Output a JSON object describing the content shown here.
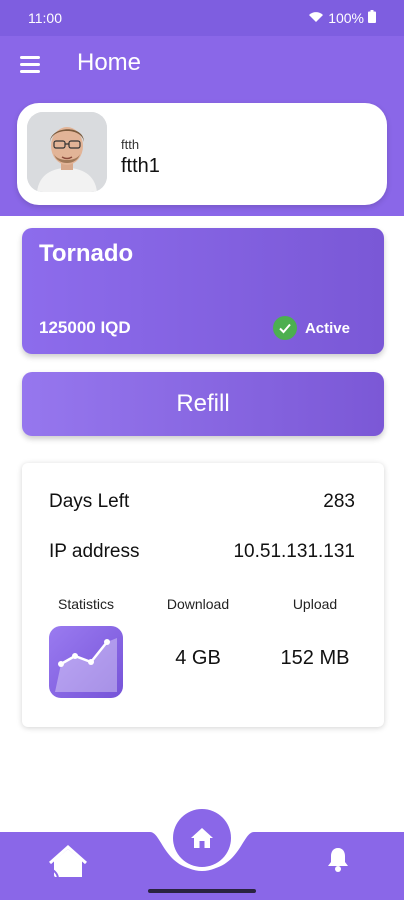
{
  "status_bar": {
    "time": "11:00",
    "battery": "100%"
  },
  "app_bar": {
    "title": "Home"
  },
  "profile": {
    "username": "ftth",
    "name": "ftth1"
  },
  "plan": {
    "name": "Tornado",
    "price": "125000 IQD",
    "status": "Active"
  },
  "refill": {
    "label": "Refill"
  },
  "info": {
    "days_left_label": "Days Left",
    "days_left_value": "283",
    "ip_label": "IP address",
    "ip_value": "10.51.131.131",
    "statistics_label": "Statistics",
    "download_label": "Download",
    "download_value": "4 GB",
    "upload_label": "Upload",
    "upload_value": "152 MB"
  },
  "colors": {
    "primary": "#8a67e8",
    "status_bar": "#7e5ee0",
    "active_green": "#4caf50"
  },
  "icons": {
    "menu": "menu-icon",
    "wifi": "wifi-icon",
    "battery": "battery-icon",
    "check": "check-icon",
    "stats": "chart-icon",
    "nav_left": "home-wifi-icon",
    "nav_center": "home-icon",
    "nav_right": "bell-icon"
  }
}
